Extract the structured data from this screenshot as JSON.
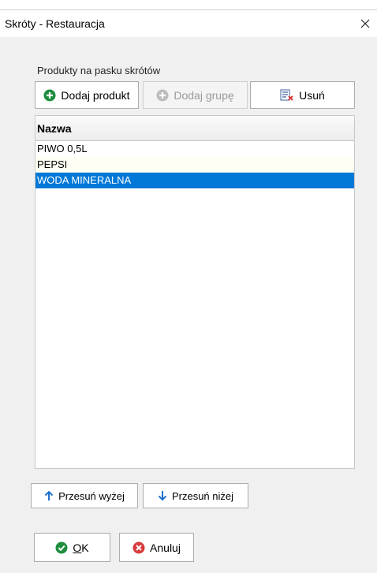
{
  "window": {
    "title": "Skróty - Restauracja"
  },
  "section": {
    "label": "Produkty na pasku skrótów"
  },
  "toolbar": {
    "add_product_label": "Dodaj produkt",
    "add_group_label": "Dodaj grupę",
    "delete_label": "Usuń"
  },
  "grid": {
    "column_header": "Nazwa",
    "rows": [
      "PIWO 0,5L",
      "PEPSI",
      "WODA MINERALNA"
    ],
    "selected_index": 2
  },
  "move": {
    "up_label": "Przesuń wyżej",
    "down_label": "Przesuń niżej"
  },
  "footer": {
    "ok_label": "OK",
    "cancel_label": "Anuluj"
  },
  "colors": {
    "selection": "#0078d7",
    "add_icon": "#1e8e3e",
    "cancel_icon": "#d83b3b",
    "arrow_icon": "#1e6fd0"
  }
}
